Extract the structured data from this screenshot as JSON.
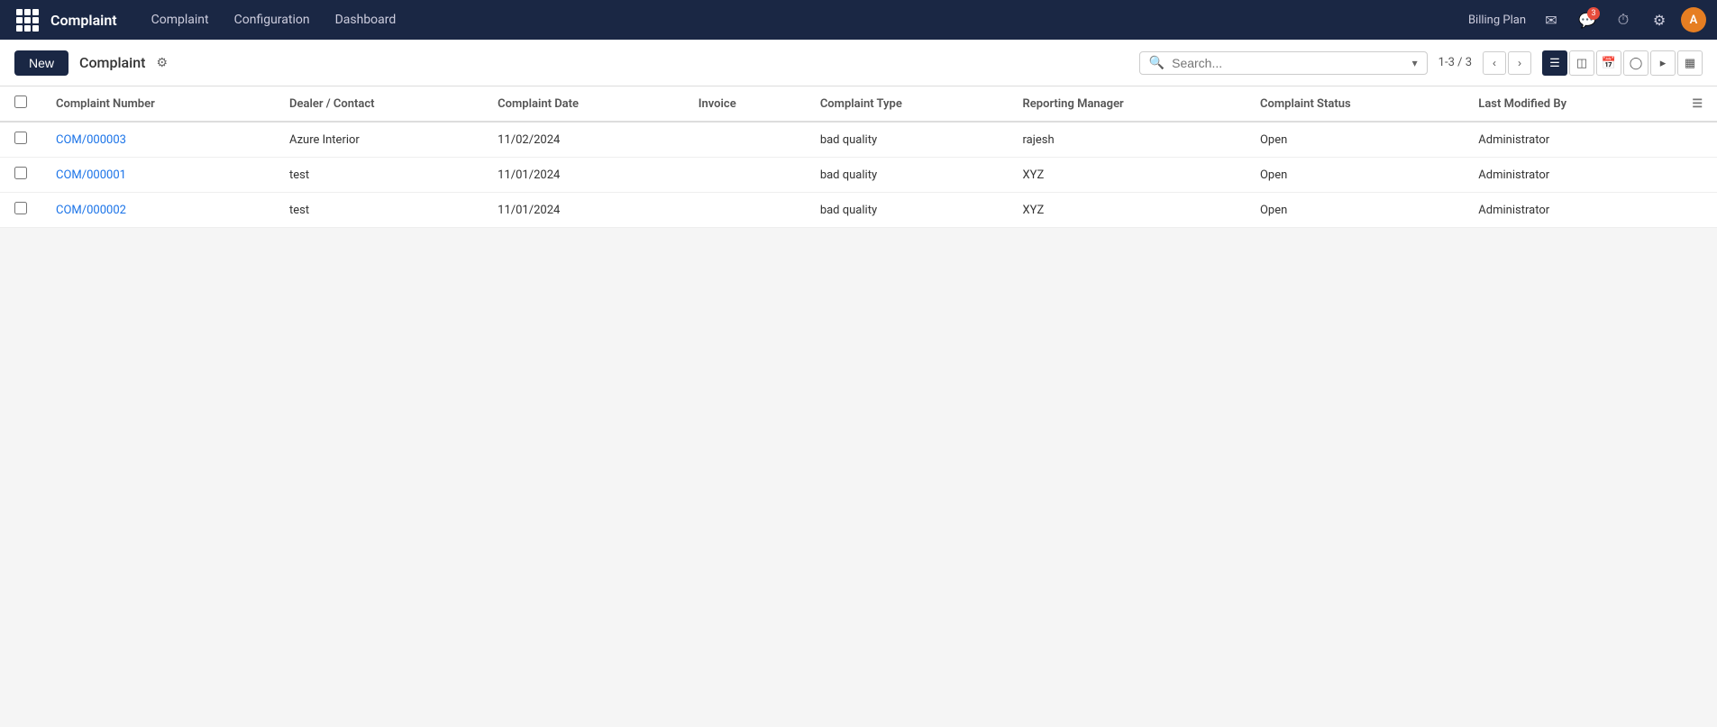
{
  "navbar": {
    "brand": "Complaint",
    "menu_items": [
      "Complaint",
      "Configuration",
      "Dashboard"
    ],
    "billing_plan_label": "Billing Plan",
    "notification_count": "3"
  },
  "subheader": {
    "new_button_label": "New",
    "page_title": "Complaint",
    "search_placeholder": "Search...",
    "pagination": "1-3 / 3"
  },
  "table": {
    "columns": [
      "Complaint Number",
      "Dealer / Contact",
      "Complaint Date",
      "Invoice",
      "Complaint Type",
      "Reporting Manager",
      "Complaint Status",
      "Last Modified By"
    ],
    "rows": [
      {
        "complaint_number": "COM/000003",
        "dealer_contact": "Azure Interior",
        "complaint_date": "11/02/2024",
        "invoice": "",
        "complaint_type": "bad quality",
        "reporting_manager": "rajesh",
        "complaint_status": "Open",
        "last_modified_by": "Administrator"
      },
      {
        "complaint_number": "COM/000001",
        "dealer_contact": "test",
        "complaint_date": "11/01/2024",
        "invoice": "",
        "complaint_type": "bad quality",
        "reporting_manager": "XYZ",
        "complaint_status": "Open",
        "last_modified_by": "Administrator"
      },
      {
        "complaint_number": "COM/000002",
        "dealer_contact": "test",
        "complaint_date": "11/01/2024",
        "invoice": "",
        "complaint_type": "bad quality",
        "reporting_manager": "XYZ",
        "complaint_status": "Open",
        "last_modified_by": "Administrator"
      }
    ]
  }
}
